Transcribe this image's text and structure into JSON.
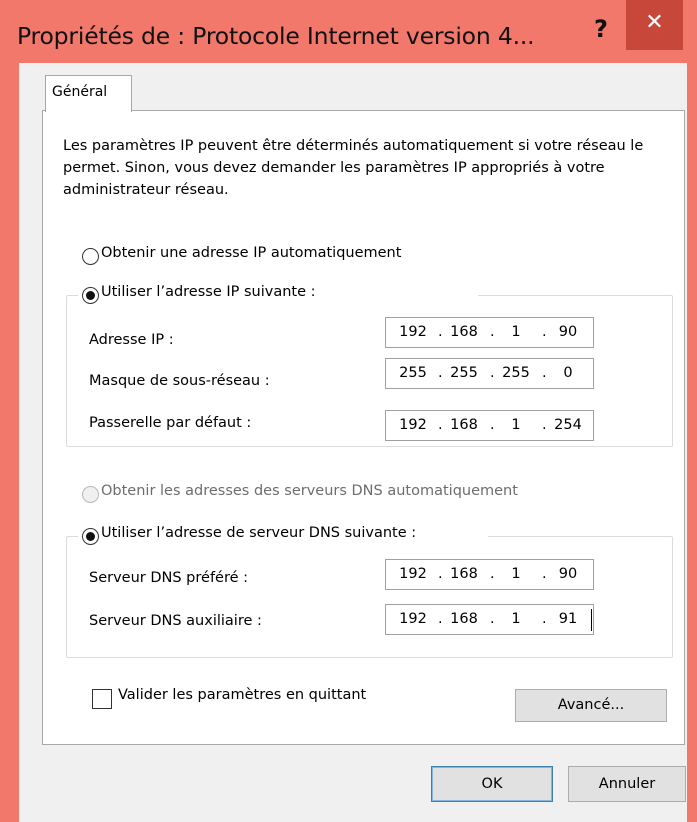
{
  "window": {
    "title": "Propriétés de : Protocole Internet version 4...",
    "help_label": "?",
    "close_label": "✕"
  },
  "tabs": [
    {
      "label": "Général"
    }
  ],
  "intro_text": "Les paramètres IP peuvent être déterminés automatiquement si votre réseau le permet. Sinon, vous devez demander les paramètres IP appropriés à votre administrateur réseau.",
  "ip": {
    "auto_label": "Obtenir une adresse IP automatiquement",
    "auto_checked": false,
    "manual_label": "Utiliser l’adresse IP suivante :",
    "manual_checked": true,
    "fields": [
      {
        "label": "Adresse IP :",
        "octets": [
          "192",
          "168",
          "1",
          "90"
        ]
      },
      {
        "label": "Masque de sous-réseau :",
        "octets": [
          "255",
          "255",
          "255",
          "0"
        ]
      },
      {
        "label": "Passerelle par défaut :",
        "octets": [
          "192",
          "168",
          "1",
          "254"
        ]
      }
    ]
  },
  "dns": {
    "auto_label": "Obtenir les adresses des serveurs DNS automatiquement",
    "auto_enabled": false,
    "manual_label": "Utiliser l’adresse de serveur DNS suivante :",
    "manual_checked": true,
    "fields": [
      {
        "label": "Serveur DNS préféré :",
        "octets": [
          "192",
          "168",
          "1",
          "90"
        ]
      },
      {
        "label": "Serveur DNS auxiliaire :",
        "octets": [
          "192",
          "168",
          "1",
          "91"
        ]
      }
    ]
  },
  "validate": {
    "label": "Valider les paramètres en quittant",
    "checked": false
  },
  "buttons": {
    "advanced": "Avancé...",
    "ok": "OK",
    "cancel": "Annuler"
  },
  "colors": {
    "titlebar": "#f1786a",
    "close_button": "#c7473a"
  },
  "icons": {
    "help": "help-icon",
    "close": "close-icon"
  }
}
